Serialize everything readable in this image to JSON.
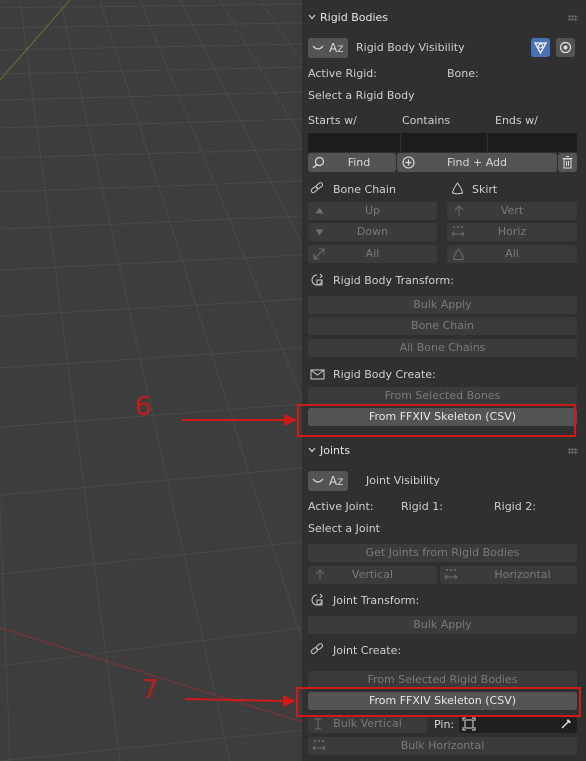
{
  "rigid_bodies": {
    "header": "Rigid Bodies",
    "visibility_label": "Rigid Body Visibility",
    "active_rigid_label": "Active Rigid:",
    "bone_label": "Bone:",
    "select_hint": "Select a Rigid Body",
    "search": {
      "starts": "Starts w/",
      "contains": "Contains",
      "ends": "Ends w/"
    },
    "find_button": "Find",
    "find_add_button": "Find + Add",
    "bone_chain": {
      "title": "Bone Chain",
      "up": "Up",
      "down": "Down",
      "all": "All"
    },
    "skirt": {
      "title": "Skirt",
      "vert": "Vert",
      "horiz": "Horiz",
      "all": "All"
    },
    "transform": {
      "title": "Rigid Body Transform:",
      "bulk_apply": "Bulk Apply",
      "bone_chain": "Bone Chain",
      "all_bone_chains": "All Bone Chains"
    },
    "create": {
      "title": "Rigid Body Create:",
      "from_selected": "From Selected Bones",
      "from_ffxiv": "From FFXIV Skeleton (CSV)"
    }
  },
  "joints": {
    "header": "Joints",
    "visibility_label": "Joint Visibility",
    "active_joint_label": "Active Joint:",
    "rigid1_label": "Rigid 1:",
    "rigid2_label": "Rigid 2:",
    "select_hint": "Select a Joint",
    "get_joints": "Get Joints from Rigid Bodies",
    "vertical": "Vertical",
    "horizontal": "Horizontal",
    "transform": {
      "title": "Joint Transform:",
      "bulk_apply": "Bulk Apply"
    },
    "create": {
      "title": "Joint Create:",
      "from_selected": "From Selected Rigid Bodies",
      "from_ffxiv": "From FFXIV Skeleton (CSV)"
    },
    "bulk_vertical": "Bulk Vertical",
    "pin_label": "Pin:",
    "bulk_horizontal": "Bulk Horizontal"
  },
  "annotations": {
    "step6": "6",
    "step7": "7"
  },
  "colors": {
    "annotation_red": "#d01a1a",
    "panel_bg": "#303030",
    "button_bg": "#545454",
    "toggle_blue": "#4772b3"
  }
}
